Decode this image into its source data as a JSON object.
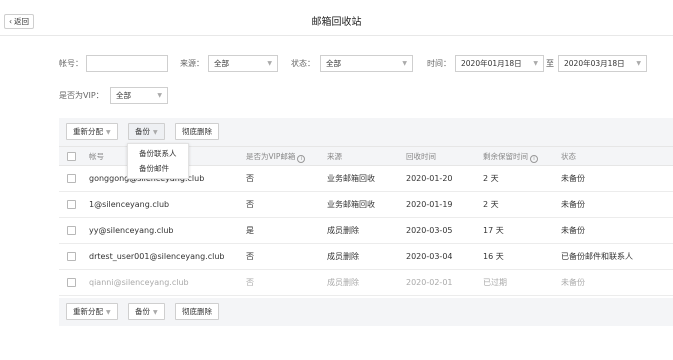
{
  "header": {
    "back_label": "返回",
    "back_icon": "chevron-left-icon",
    "title": "邮箱回收站"
  },
  "filters": {
    "account_label": "帐号：",
    "account_value": "",
    "source_label": "来源：",
    "source_value": "全部",
    "status_label": "状态：",
    "status_value": "全部",
    "time_label": "时间：",
    "date_from": "2020年01月18日",
    "date_sep": "至",
    "date_to": "2020年03月18日",
    "vip_label": "是否为VIP：",
    "vip_value": "全部"
  },
  "toolbar": {
    "reassign_label": "重新分配",
    "backup_label": "备份",
    "delete_label": "彻底删除"
  },
  "backup_menu": {
    "items": [
      "备份联系人",
      "备份邮件"
    ]
  },
  "table": {
    "headers": [
      "帐号",
      "是否为VIP邮箱",
      "来源",
      "回收时间",
      "剩余保留时间",
      "状态"
    ],
    "rows": [
      {
        "account": "gonggong@silenceyang.club",
        "vip": "否",
        "source": "业务邮箱回收",
        "time": "2020-01-20",
        "remaining": "2 天",
        "status": "未备份"
      },
      {
        "account": "1@silenceyang.club",
        "vip": "否",
        "source": "业务邮箱回收",
        "time": "2020-01-19",
        "remaining": "2 天",
        "status": "未备份"
      },
      {
        "account": "yy@silenceyang.club",
        "vip": "是",
        "source": "成员删除",
        "time": "2020-03-05",
        "remaining": "17 天",
        "status": "未备份"
      },
      {
        "account": "drtest_user001@silenceyang.club",
        "vip": "否",
        "source": "成员删除",
        "time": "2020-03-04",
        "remaining": "16 天",
        "status": "已备份邮件和联系人"
      },
      {
        "account": "qianni@silenceyang.club",
        "vip": "否",
        "source": "成员删除",
        "time": "2020-02-01",
        "remaining": "已过期",
        "status": "未备份"
      }
    ]
  },
  "colors": {
    "toolbar_bg": "#f4f5f7",
    "border": "#cfcfcf",
    "text": "#333333",
    "muted": "#aaaaaa"
  }
}
